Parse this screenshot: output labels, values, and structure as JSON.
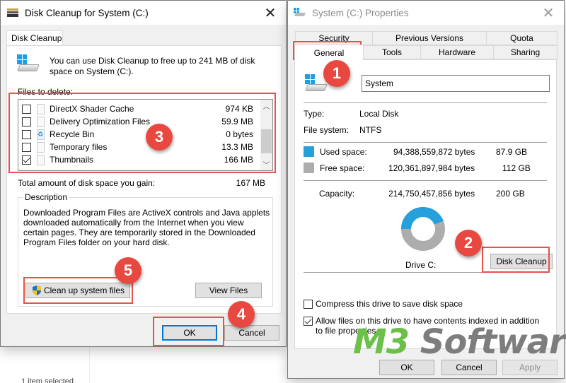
{
  "background": {
    "status_text": "1 item selected"
  },
  "disk_cleanup_dialog": {
    "title": "Disk Cleanup for System (C:)",
    "icon": "disk-cleanup-icon",
    "close_icon": "close-icon",
    "tab_label": "Disk Cleanup",
    "intro_text": "You can use Disk Cleanup to free up to 241 MB of disk space on System (C:).",
    "files_label": "Files to delete:",
    "files": [
      {
        "name": "DirectX Shader Cache",
        "size": "974 KB",
        "checked": false,
        "icon": "file-icon"
      },
      {
        "name": "Delivery Optimization Files",
        "size": "59.9 MB",
        "checked": false,
        "icon": "file-icon"
      },
      {
        "name": "Recycle Bin",
        "size": "0 bytes",
        "checked": false,
        "icon": "recycle-bin-icon"
      },
      {
        "name": "Temporary files",
        "size": "13.3 MB",
        "checked": false,
        "icon": "file-icon"
      },
      {
        "name": "Thumbnails",
        "size": "166 MB",
        "checked": true,
        "icon": "file-icon"
      }
    ],
    "total_label": "Total amount of disk space you gain:",
    "total_value": "167 MB",
    "description_legend": "Description",
    "description_text": "Downloaded Program Files are ActiveX controls and Java applets downloaded automatically from the Internet when you view certain pages. They are temporarily stored in the Downloaded Program Files folder on your hard disk.",
    "cleanup_system_button": "Clean up system files",
    "view_files_button": "View Files",
    "ok_button": "OK",
    "cancel_button": "Cancel"
  },
  "properties_dialog": {
    "title": "System (C:) Properties",
    "close_icon": "close-icon",
    "tabs_row1": [
      "Security",
      "Previous Versions",
      "Quota"
    ],
    "tabs_row2": [
      "General",
      "Tools",
      "Hardware",
      "Sharing"
    ],
    "active_tab": "General",
    "drive_name": "System",
    "type_label": "Type:",
    "type_value": "Local Disk",
    "fs_label": "File system:",
    "fs_value": "NTFS",
    "used_label": "Used space:",
    "used_bytes": "94,388,559,872 bytes",
    "used_gb": "87.9 GB",
    "used_color": "#26a0da",
    "free_label": "Free space:",
    "free_bytes": "120,361,897,984 bytes",
    "free_gb": "112 GB",
    "free_color": "#adadad",
    "capacity_label": "Capacity:",
    "capacity_bytes": "214,750,457,856 bytes",
    "capacity_gb": "200 GB",
    "used_fraction": 0.4395,
    "drive_label": "Drive C:",
    "disk_cleanup_button": "Disk Cleanup",
    "compress_label": "Compress this drive to save disk space",
    "compress_checked": false,
    "index_label": "Allow files on this drive to have contents indexed in addition to file properties",
    "index_checked": true,
    "ok_button": "OK",
    "cancel_button": "Cancel",
    "apply_button": "Apply"
  },
  "annotations": {
    "highlight_color": "#e8524a",
    "badges": [
      "1",
      "2",
      "3",
      "4",
      "5"
    ]
  },
  "watermark": {
    "part1": "M3",
    "part2": " Software"
  }
}
